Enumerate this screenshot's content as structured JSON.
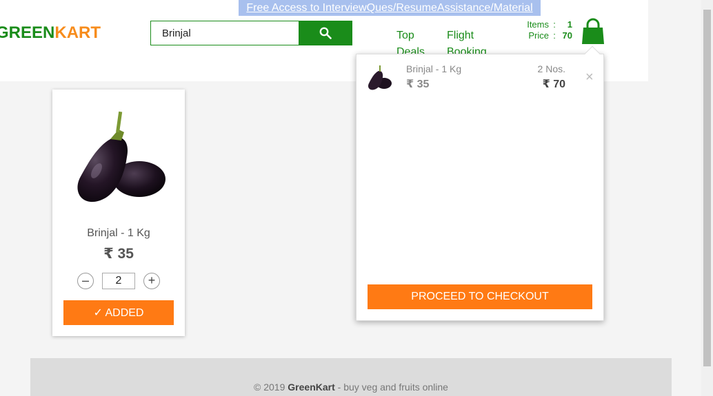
{
  "header": {
    "promo_link": "Free Access to InterviewQues/ResumeAssistance/Material",
    "brand_green": "GREEN",
    "brand_orange": "KART",
    "search": {
      "value": "Brinjal",
      "icon": "search-icon"
    },
    "nav": [
      {
        "label": "Top Deals"
      },
      {
        "label": "Flight Booking"
      }
    ],
    "cart_info": {
      "items_label": "Items",
      "items_value": "1",
      "price_label": "Price",
      "price_value": "70",
      "separator": ":"
    },
    "cart_icon": "shopping-bag-icon"
  },
  "product": {
    "name": "Brinjal - 1 Kg",
    "price": "₹ 35",
    "decrement": "–",
    "increment": "+",
    "quantity": "2",
    "added_label": "✓ ADDED"
  },
  "cart_preview": {
    "item_name": "Brinjal - 1 Kg",
    "item_price": "₹ 35",
    "item_qty": "2 Nos.",
    "item_amount": "₹ 70",
    "remove": "×",
    "checkout_label": "PROCEED TO CHECKOUT"
  },
  "footer": {
    "prefix": "© 2019",
    "brand": "GreenKart",
    "suffix": "- buy veg and fruits online"
  },
  "colors": {
    "green": "#1a8c1a",
    "orange": "#ff7a14",
    "promo_bg": "#a8c0ee"
  }
}
